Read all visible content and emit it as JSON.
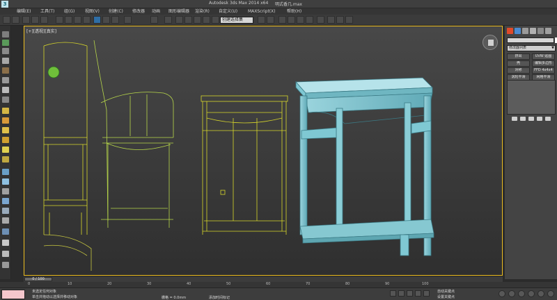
{
  "titlebar": {
    "logo_text": "3",
    "title": "Autodesk 3ds Max  2014 x64",
    "doc_name": "明式香几.max"
  },
  "menu": {
    "items": [
      {
        "label": "编辑(E)"
      },
      {
        "label": "工具(T)"
      },
      {
        "label": "组(G)"
      },
      {
        "label": "视图(V)"
      },
      {
        "label": "创建(C)"
      },
      {
        "label": "修改器"
      },
      {
        "label": "动画"
      },
      {
        "label": "图形编辑器"
      },
      {
        "label": "渲染(R)"
      },
      {
        "label": "自定义(U)"
      },
      {
        "label": "MAXScript(X)"
      },
      {
        "label": "帮助(H)"
      }
    ]
  },
  "toolbar": {
    "selection_set_label": "创建选择集"
  },
  "viewport": {
    "label": "[+][透视][真实]",
    "wire_color": "#e9e22a",
    "table_color": "#7fc8d3",
    "border_color": "#f0c020"
  },
  "command_panel": {
    "dropdown_label": "修改器列表",
    "buttons": [
      {
        "label": "挤出"
      },
      {
        "label": "UVW 贴图"
      },
      {
        "label": "壳"
      },
      {
        "label": "编辑多边形"
      },
      {
        "label": "对称"
      },
      {
        "label": "FFD 4x4x4"
      },
      {
        "label": "涡轮平滑"
      },
      {
        "label": "网格平滑"
      }
    ]
  },
  "timeline": {
    "slider_text": "0 / 100",
    "ticks": [
      "0",
      "10",
      "20",
      "30",
      "40",
      "50",
      "60",
      "70",
      "80",
      "90",
      "100"
    ]
  },
  "status": {
    "line1": "未选定任何对象",
    "line2": "单击并拖动以选择并移动对象",
    "coords": "栅格 = 0.0mm",
    "add_time_tag": "添加时间标记",
    "auto_key": "自动关键点",
    "set_key": "设置关键点"
  }
}
